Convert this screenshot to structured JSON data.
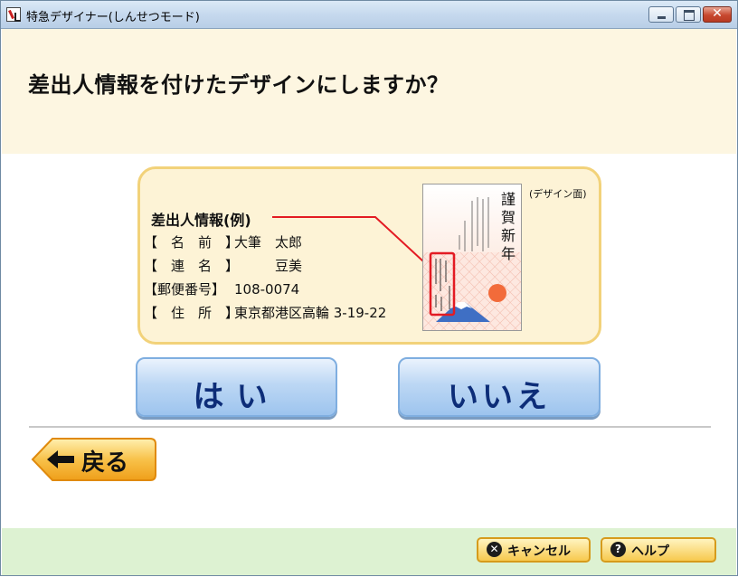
{
  "window": {
    "title": "特急デザイナー(しんせつモード)"
  },
  "header": {
    "question": "差出人情報を付けたデザインにしますか？"
  },
  "sample": {
    "title": "差出人情報(例)",
    "rows": [
      {
        "label": "【　名　前　】",
        "value": "大筆　太郎"
      },
      {
        "label": "【　連　名　】",
        "value": "　　　豆美"
      },
      {
        "label": "【郵便番号】",
        "value": "108-0074"
      },
      {
        "label": "【　住　所　】",
        "value": "東京都港区高輪 3-19-22"
      }
    ],
    "design_label": "(デザイン面)",
    "card_text": "謹賀新年",
    "highlight_color": "#e31b23"
  },
  "buttons": {
    "yes": "はい",
    "no": "いいえ",
    "back": "戻る"
  },
  "footer": {
    "cancel": "キャンセル",
    "help": "ヘルプ"
  }
}
